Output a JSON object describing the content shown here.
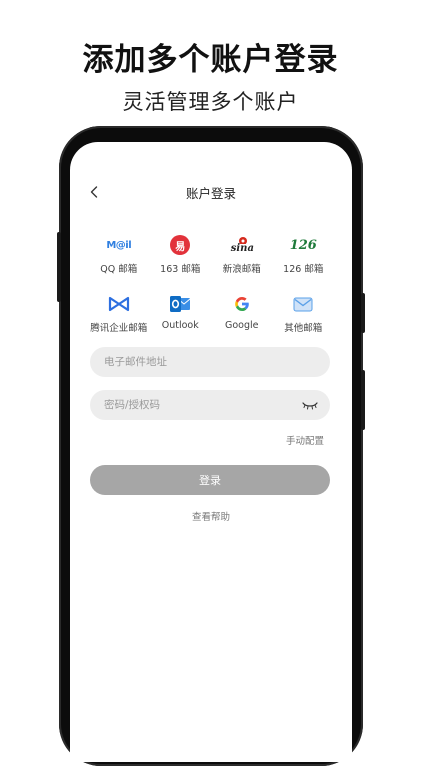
{
  "promo": {
    "headline": "添加多个账户登录",
    "subline": "灵活管理多个账户"
  },
  "screen": {
    "title": "账户登录",
    "back_icon": "chevron-left-icon"
  },
  "providers": [
    {
      "id": "qq",
      "label": "QQ 邮箱",
      "logo_text": "M@il",
      "icon": "qq-mail-icon",
      "color": "#2f7fe0"
    },
    {
      "id": "163",
      "label": "163 邮箱",
      "logo_text": "易",
      "icon": "netease-163-icon",
      "color": "#e2323b"
    },
    {
      "id": "sina",
      "label": "新浪邮箱",
      "logo_text": "sina",
      "icon": "sina-icon",
      "color": "#d52a1d"
    },
    {
      "id": "126",
      "label": "126 邮箱",
      "logo_text": "126",
      "icon": "mail-126-icon",
      "color": "#1e7a3a"
    },
    {
      "id": "tencent",
      "label": "腾讯企业邮箱",
      "icon": "tencent-exmail-icon",
      "color": "#2d6fe0"
    },
    {
      "id": "outlook",
      "label": "Outlook",
      "icon": "outlook-icon",
      "color": "#0f6cc4"
    },
    {
      "id": "google",
      "label": "Google",
      "icon": "google-icon",
      "color": "#4285f4"
    },
    {
      "id": "other",
      "label": "其他邮箱",
      "icon": "other-mail-icon",
      "color": "#5aa0e8"
    }
  ],
  "form": {
    "email_placeholder": "电子邮件地址",
    "password_placeholder": "密码/授权码",
    "eye_icon": "eye-closed-icon",
    "manual_config": "手动配置",
    "login_label": "登录",
    "help": "查看帮助"
  }
}
